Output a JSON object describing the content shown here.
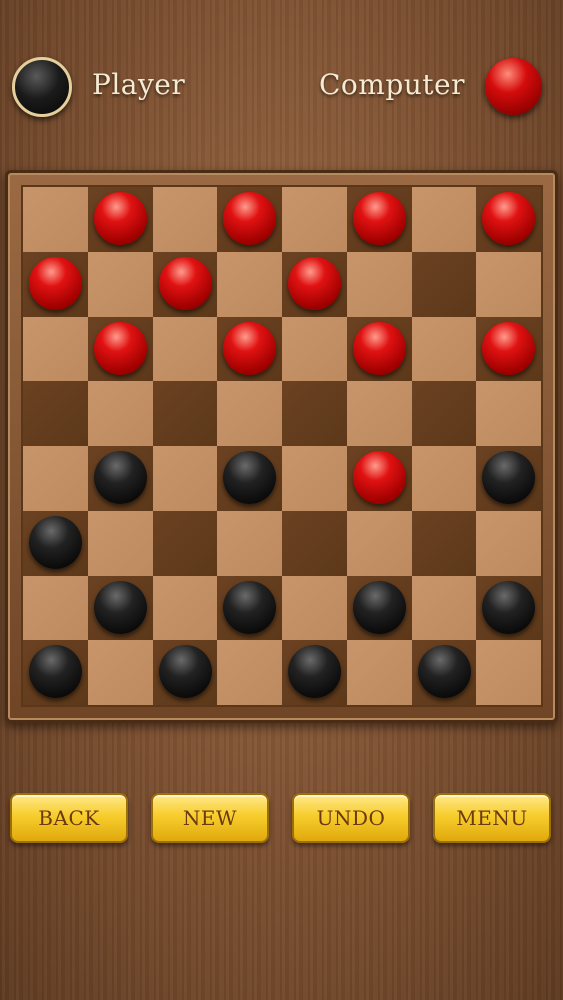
{
  "header": {
    "player_label": "Player",
    "computer_label": "Computer",
    "player_color": "#111111",
    "computer_color": "#cc0000"
  },
  "board": {
    "size": 8,
    "light_color": "#c8956a",
    "dark_color": "#5f3a1b",
    "rows": [
      [
        "",
        "r",
        "",
        "r",
        "",
        "r",
        "",
        "r"
      ],
      [
        "r",
        "",
        "r",
        "",
        "r",
        "",
        "",
        ""
      ],
      [
        "",
        "r",
        "",
        "r",
        "",
        "r",
        "",
        "r"
      ],
      [
        "",
        "",
        "",
        "",
        "",
        "",
        "",
        ""
      ],
      [
        "",
        "b",
        "",
        "b",
        "",
        "r",
        "",
        "b"
      ],
      [
        "b",
        "",
        "",
        "",
        "",
        "",
        "",
        ""
      ],
      [
        "",
        "b",
        "",
        "b",
        "",
        "b",
        "",
        "b"
      ],
      [
        "b",
        "",
        "b",
        "",
        "b",
        "",
        "b",
        ""
      ]
    ]
  },
  "controls": {
    "back_label": "BACK",
    "new_label": "NEW",
    "undo_label": "UNDO",
    "menu_label": "MENU"
  }
}
